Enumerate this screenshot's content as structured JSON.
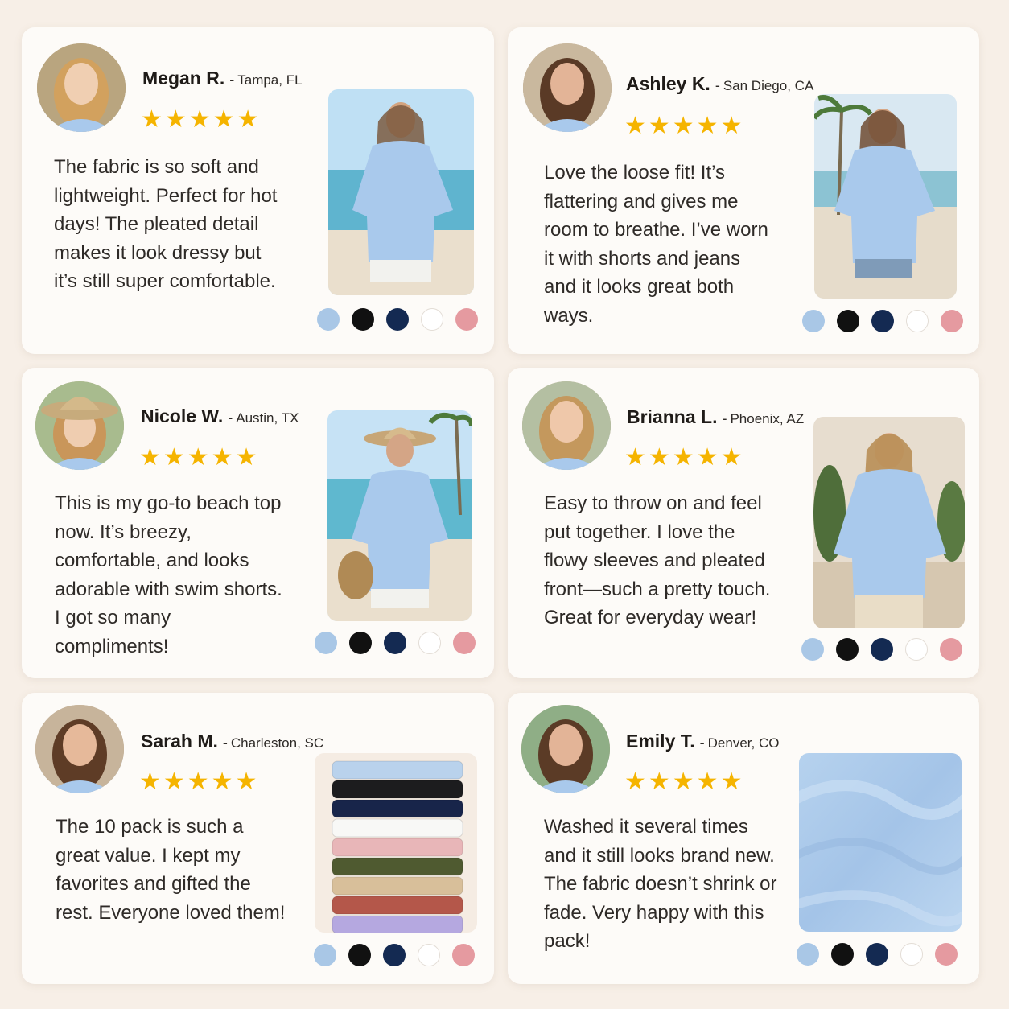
{
  "colors": {
    "background": "#f7efe7",
    "card": "#fdfbf8",
    "star": "#f5b400",
    "shirt_blue": "#a9c9ec"
  },
  "swatch_colors": [
    {
      "name": "light-blue",
      "hex": "#a9c7e6"
    },
    {
      "name": "black",
      "hex": "#111111"
    },
    {
      "name": "navy",
      "hex": "#142a52"
    },
    {
      "name": "white",
      "hex": "#ffffff"
    },
    {
      "name": "pink",
      "hex": "#e59aa0"
    }
  ],
  "reviews": [
    {
      "name": "Megan R.",
      "separator": "-",
      "location": "Tampa, FL",
      "stars": "★★★★★",
      "rating": 5,
      "text": "The fabric is so soft and lightweight. Perfect for hot days! The pleated detail makes it look dressy but it’s still super comfortable.",
      "photo": "model-beach-shirt-photo"
    },
    {
      "name": "Ashley K.",
      "separator": "-",
      "location": "San Diego, CA",
      "stars": "★★★★★",
      "rating": 5,
      "text": "Love the loose fit! It’s flattering and gives me room to breathe. I’ve worn it with shorts and jeans and it looks great both ways.",
      "photo": "model-palm-beach-photo"
    },
    {
      "name": "Nicole W.",
      "separator": "-",
      "location": "Austin, TX",
      "stars": "★★★★★",
      "rating": 5,
      "text": "This is my go-to beach top now. It’s breezy, comfortable, and looks adorable with swim shorts. I got so many compliments!",
      "photo": "model-hat-beach-photo"
    },
    {
      "name": "Brianna L.",
      "separator": "-",
      "location": "Phoenix, AZ",
      "stars": "★★★★★",
      "rating": 5,
      "text": "Easy to throw on and feel put together. I love the flowy sleeves and pleated front—such a pretty touch. Great for everyday wear!",
      "photo": "model-patio-photo"
    },
    {
      "name": "Sarah M.",
      "separator": "-",
      "location": "Charleston, SC",
      "stars": "★★★★★",
      "rating": 5,
      "text": "The 10 pack is such a great value. I kept my favorites and gifted the rest. Everyone loved them!",
      "photo": "folded-shirts-stack-photo"
    },
    {
      "name": "Emily T.",
      "separator": "-",
      "location": "Denver, CO",
      "stars": "★★★★★",
      "rating": 5,
      "text": "Washed it several times and it still looks brand new. The fabric doesn’t shrink or fade. Very happy with this pack!",
      "photo": "fabric-closeup-photo"
    }
  ],
  "stack_colors": [
    "#b9d2ec",
    "#1c1c1e",
    "#18254a",
    "#f8f8f6",
    "#e8b6b8",
    "#4f5a30",
    "#d8bf9a",
    "#b4574a",
    "#b5a8e0"
  ]
}
